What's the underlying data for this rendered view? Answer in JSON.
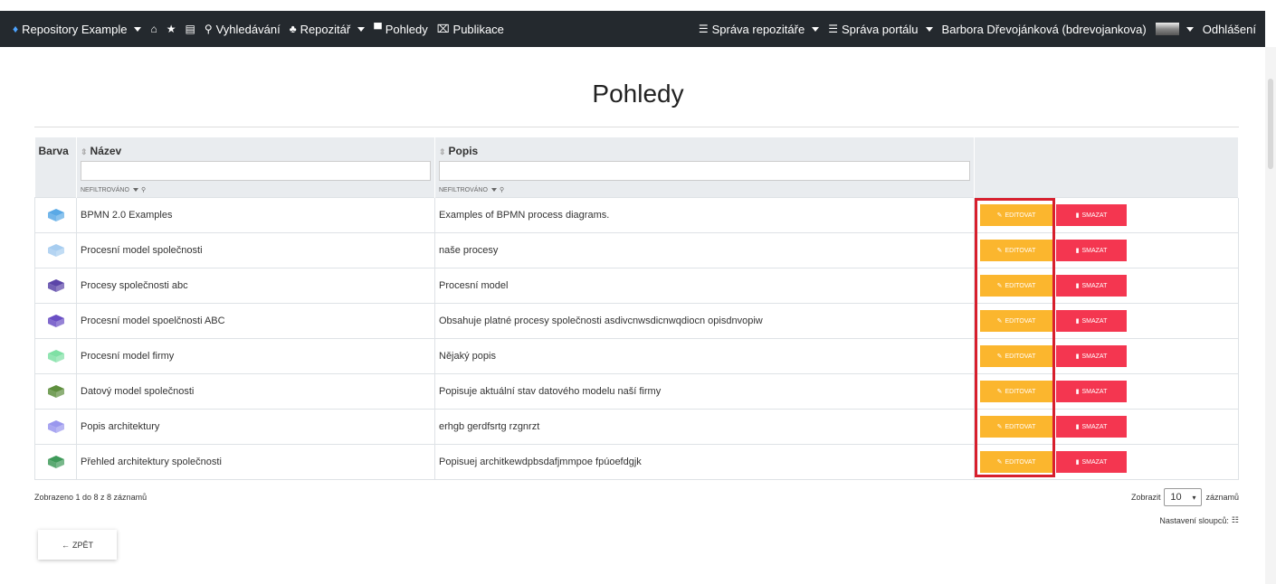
{
  "nav": {
    "brand": "Repository Example",
    "search": "Vyhledávání",
    "repository": "Repozitář",
    "views": "Pohledy",
    "publications": "Publikace",
    "repo_admin": "Správa repozitáře",
    "portal_admin": "Správa portálu",
    "user": "Barbora Dřevojánková (bdrevojankova)",
    "logout": "Odhlášení"
  },
  "page": {
    "title": "Pohledy"
  },
  "table": {
    "headers": {
      "color": "Barva",
      "name": "Název",
      "description": "Popis"
    },
    "filter_label": "NEFILTROVÁNO",
    "edit_label": "EDITOVAT",
    "delete_label": "SMAZAT",
    "rows": [
      {
        "name": "BPMN 2.0 Examples",
        "description": "Examples of BPMN process diagrams.",
        "color": "#5aa9e6"
      },
      {
        "name": "Procesní model společnosti",
        "description": "naše procesy",
        "color": "#a7cdf0"
      },
      {
        "name": "Procesy společnosti abc",
        "description": "Procesní model",
        "color": "#5b45a8"
      },
      {
        "name": "Procesní model spoelčnosti ABC",
        "description": "Obsahuje platné procesy společnosti asdivcnwsdicnwqdiocn opisdnvopiw",
        "color": "#6a4fc4"
      },
      {
        "name": "Procesní model firmy",
        "description": "Nějaký popis",
        "color": "#7fe0a4"
      },
      {
        "name": "Datový model společnosti",
        "description": "Popisuje aktuální stav datového modelu naší firmy",
        "color": "#5e8f3e"
      },
      {
        "name": "Popis architektury",
        "description": "erhgb gerdfsrtg rzgnrzt",
        "color": "#9a97ee"
      },
      {
        "name": "Přehled architektury společnosti",
        "description": "Popisuej architkewdpbsdafjmmpoe fpúoefdgjk",
        "color": "#3f9a5a"
      }
    ]
  },
  "footer": {
    "summary": "Zobrazeno 1 do 8 z 8 záznamů",
    "show_label": "Zobrazit",
    "page_size": "10",
    "records_label": "záznamů",
    "column_settings": "Nastavení sloupců:",
    "back": "ZPĚT"
  }
}
